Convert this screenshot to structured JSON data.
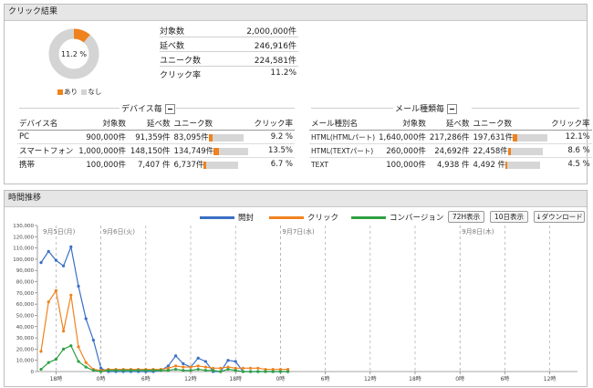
{
  "click_result": {
    "header": "クリック結果",
    "donut": {
      "center_label": "11.2 %",
      "click_rate_pct": 11.2,
      "legend_yes": "あり",
      "legend_no": "なし",
      "color_yes": "#f0821e",
      "color_no": "#d4d4d4"
    },
    "summary": [
      {
        "label": "対象数",
        "value": "2,000,000件"
      },
      {
        "label": "延べ数",
        "value": "246,916件"
      },
      {
        "label": "ユニーク数",
        "value": "224,581件"
      },
      {
        "label": "クリック率",
        "value": "11.2%"
      }
    ],
    "device": {
      "title": "デバイス毎",
      "headers": [
        "デバイス名",
        "対象数",
        "延べ数",
        "ユニーク数",
        "クリック率"
      ],
      "rows": [
        {
          "name": "PC",
          "target": "900,000件",
          "total": "91,359件",
          "unique": "83,095件",
          "rate": "9.2 %",
          "rate_pct": 9.2
        },
        {
          "name": "スマートフォン",
          "target": "1,000,000件",
          "total": "148,150件",
          "unique": "134,749件",
          "rate": "13.5%",
          "rate_pct": 13.5
        },
        {
          "name": "携帯",
          "target": "100,000件",
          "total": "7,407 件",
          "unique": "6,737件",
          "rate": "6.7 %",
          "rate_pct": 6.7
        }
      ]
    },
    "mail": {
      "title": "メール種類毎",
      "headers": [
        "メール種別名",
        "対象数",
        "延べ数",
        "ユニーク数",
        "クリック率"
      ],
      "rows": [
        {
          "name": "HTML(HTMLパート)",
          "target": "1,640,000件",
          "total": "217,286件",
          "unique": "197,631件",
          "rate": "12.1%",
          "rate_pct": 12.1
        },
        {
          "name": "HTML(TEXTパート)",
          "target": "260,000件",
          "total": "24,692件",
          "unique": "22,458件",
          "rate": "8.6 %",
          "rate_pct": 8.6
        },
        {
          "name": "TEXT",
          "target": "100,000件",
          "total": "4,938 件",
          "unique": "4,492 件",
          "rate": "4.5 %",
          "rate_pct": 4.5
        }
      ]
    }
  },
  "time_trend": {
    "header": "時間推移",
    "buttons": {
      "hours72": "72H表示",
      "days10": "10日表示",
      "download": "↓ダウンロード"
    },
    "chart_data": {
      "type": "line",
      "y_ticks": [
        "0",
        "10,000",
        "20,000",
        "30,000",
        "40,000",
        "50,000",
        "60,000",
        "70,000",
        "80,000",
        "90,000",
        "100,000",
        "110,000",
        "120,000",
        "130,000"
      ],
      "ylim": [
        0,
        130000
      ],
      "x_hour_labels": [
        "18時",
        "0時",
        "6時",
        "12時",
        "18時",
        "0時",
        "6時",
        "12時",
        "18時",
        "0時",
        "6時",
        "12時"
      ],
      "day_labels": [
        "9月5日(月)",
        "9月6日(火)",
        "9月7日(水)",
        "9月8日(木)"
      ],
      "x_hours": [
        0,
        1,
        2,
        3,
        4,
        5,
        6,
        7,
        8,
        9,
        10,
        11,
        12,
        13,
        14,
        15,
        16,
        17,
        18,
        19,
        20,
        21,
        22,
        23,
        24,
        25,
        26,
        27,
        28,
        29,
        30,
        31,
        32,
        33
      ],
      "series": [
        {
          "name": "開封",
          "color": "#3a6fc4",
          "values": [
            97000,
            107000,
            99000,
            94000,
            111000,
            76000,
            47000,
            28000,
            3000,
            0,
            0,
            0,
            0,
            0,
            0,
            0,
            1000,
            5000,
            14000,
            7000,
            4000,
            12000,
            9000,
            0,
            0,
            10000,
            9000,
            0,
            0,
            0,
            0,
            0,
            0,
            0
          ]
        },
        {
          "name": "クリック",
          "color": "#f0821e",
          "values": [
            18000,
            62000,
            72000,
            36000,
            68000,
            22000,
            8000,
            2000,
            1000,
            2000,
            2000,
            2000,
            2000,
            2000,
            2000,
            2000,
            2000,
            3000,
            5000,
            4000,
            4000,
            5000,
            4000,
            3000,
            3000,
            4000,
            3000,
            3000,
            3000,
            3000,
            2000,
            2000,
            2000,
            2000
          ]
        },
        {
          "name": "コンバージョン",
          "color": "#2ea043",
          "values": [
            2000,
            8000,
            11000,
            20000,
            23000,
            9000,
            4000,
            1000,
            0,
            1000,
            1000,
            1000,
            1000,
            1000,
            1000,
            1000,
            1000,
            1000,
            2000,
            1000,
            1000,
            2000,
            1000,
            1000,
            0,
            2000,
            1000,
            0,
            0,
            0,
            0,
            0,
            0,
            0
          ]
        }
      ]
    }
  }
}
